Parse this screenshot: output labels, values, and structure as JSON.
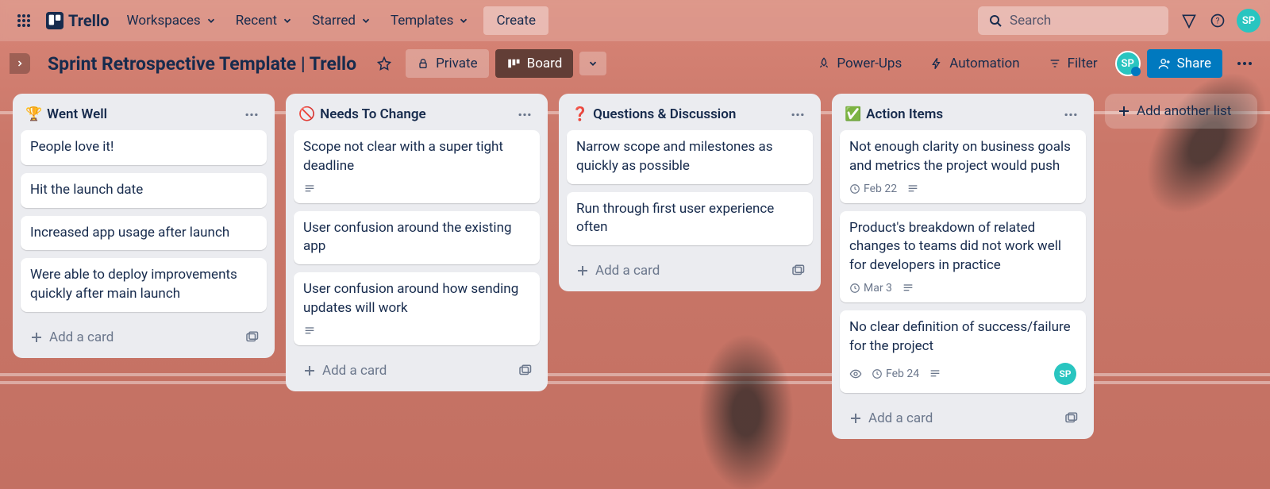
{
  "app": {
    "name": "Trello"
  },
  "nav": {
    "workspaces": "Workspaces",
    "recent": "Recent",
    "starred": "Starred",
    "templates": "Templates",
    "create": "Create"
  },
  "search": {
    "placeholder": "Search"
  },
  "user": {
    "initials": "SP"
  },
  "board": {
    "title": "Sprint Retrospective Template | Trello",
    "visibility": "Private",
    "view_label": "Board",
    "power_ups": "Power-Ups",
    "automation": "Automation",
    "filter": "Filter",
    "share": "Share",
    "add_list": "Add another list",
    "add_card": "Add a card"
  },
  "lists": [
    {
      "emoji": "🏆",
      "title": "Went Well",
      "cards": [
        {
          "title": "People love it!"
        },
        {
          "title": "Hit the launch date"
        },
        {
          "title": "Increased app usage after launch"
        },
        {
          "title": "Were able to deploy improvements quickly after main launch"
        }
      ]
    },
    {
      "emoji": "🚫",
      "title": "Needs To Change",
      "cards": [
        {
          "title": "Scope not clear with a super tight deadline",
          "desc": true
        },
        {
          "title": "User confusion around the existing app"
        },
        {
          "title": "User confusion around how sending updates will work",
          "desc": true
        }
      ]
    },
    {
      "emoji": "❓",
      "title": "Questions & Discussion",
      "cards": [
        {
          "title": "Narrow scope and milestones as quickly as possible"
        },
        {
          "title": "Run through first user experience often"
        }
      ]
    },
    {
      "emoji": "✅",
      "title": "Action Items",
      "cards": [
        {
          "title": "Not enough clarity on business goals and metrics the project would push",
          "due": "Feb 22",
          "desc": true
        },
        {
          "title": "Product's breakdown of related changes to teams did not work well for developers in practice",
          "due": "Mar 3",
          "desc": true
        },
        {
          "title": "No clear definition of success/failure for the project",
          "due": "Feb 24",
          "desc": true,
          "watch": true,
          "member": "SP"
        }
      ]
    }
  ]
}
